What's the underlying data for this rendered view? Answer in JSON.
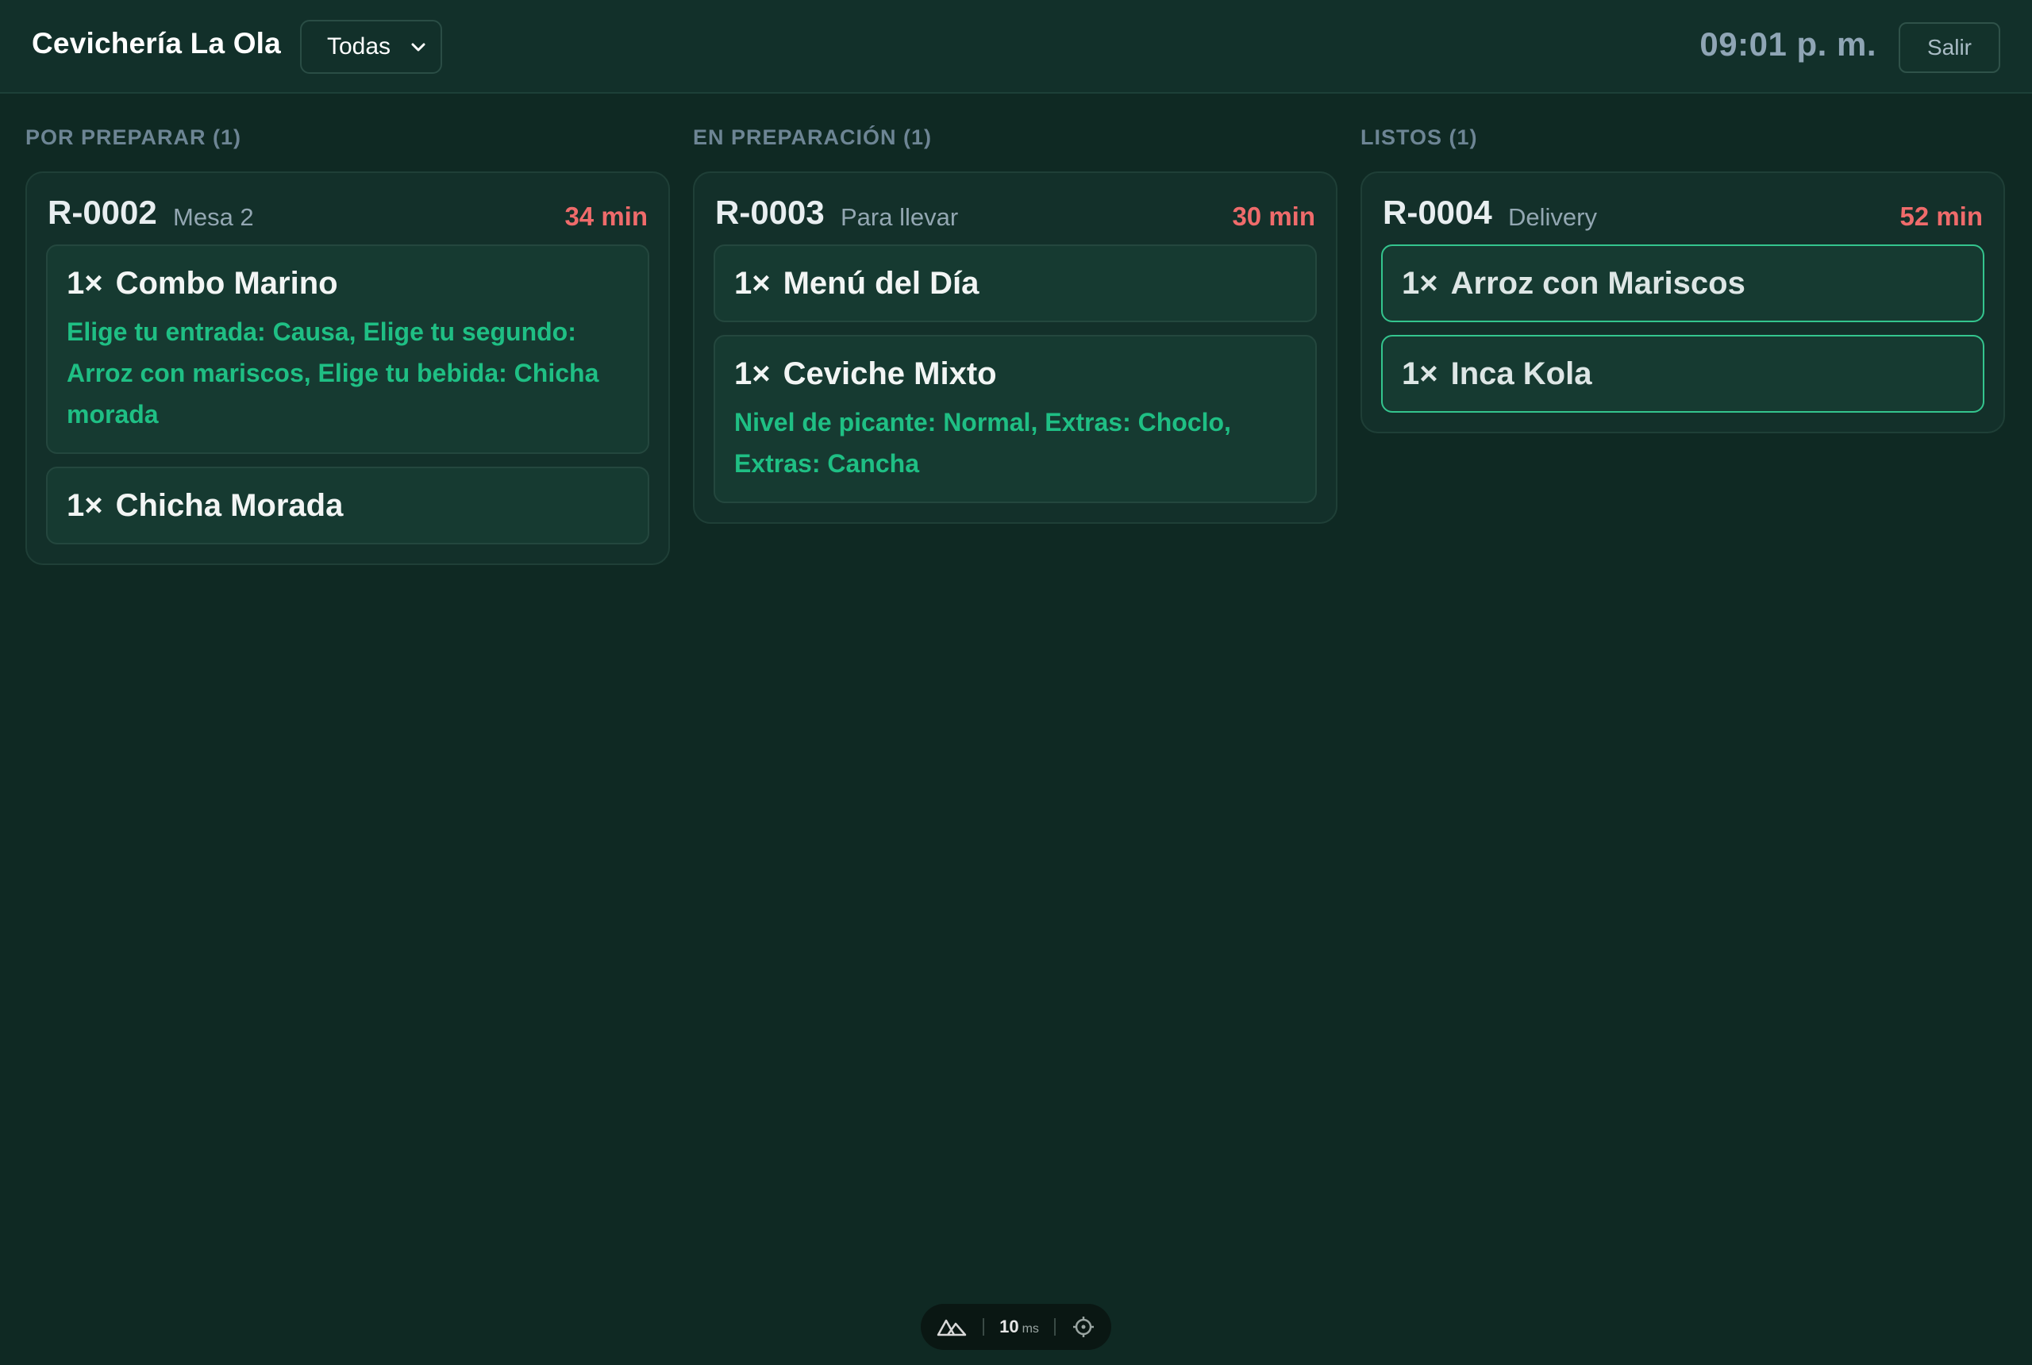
{
  "header": {
    "brand": "Cevichería La Ola",
    "station_filter": "Todas",
    "clock": "09:01 p. m.",
    "logout_label": "Salir"
  },
  "columns": [
    {
      "title": "POR PREPARAR (1)",
      "orders": [
        {
          "id": "R-0002",
          "type": "Mesa 2",
          "elapsed": "34 min",
          "items": [
            {
              "qty": "1×",
              "name": "Combo Marino",
              "mods": "Elige tu entrada: Causa, Elige tu segundo: Arroz con mariscos, Elige tu bebida: Chicha morada"
            },
            {
              "qty": "1×",
              "name": "Chicha Morada",
              "mods": ""
            }
          ]
        }
      ]
    },
    {
      "title": "EN PREPARACIÓN (1)",
      "orders": [
        {
          "id": "R-0003",
          "type": "Para llevar",
          "elapsed": "30 min",
          "items": [
            {
              "qty": "1×",
              "name": "Menú del Día",
              "mods": ""
            },
            {
              "qty": "1×",
              "name": "Ceviche Mixto",
              "mods": "Nivel de picante: Normal, Extras: Choclo, Extras: Cancha"
            }
          ]
        }
      ]
    },
    {
      "title": "LISTOS (1)",
      "orders": [
        {
          "id": "R-0004",
          "type": "Delivery",
          "elapsed": "52 min",
          "items": [
            {
              "qty": "1×",
              "name": "Arroz con Mariscos",
              "mods": ""
            },
            {
              "qty": "1×",
              "name": "Inca Kola",
              "mods": ""
            }
          ]
        }
      ]
    }
  ],
  "devtools": {
    "render_time": "10",
    "render_unit": "ms"
  },
  "colors": {
    "background": "#0f2923",
    "accent_green": "#1fbf84",
    "ready_border": "#34c58e",
    "timer_red": "#ef6b6b"
  },
  "icons": [
    "chevron-down-icon",
    "nuxt-logo-icon",
    "crosshair-icon"
  ]
}
